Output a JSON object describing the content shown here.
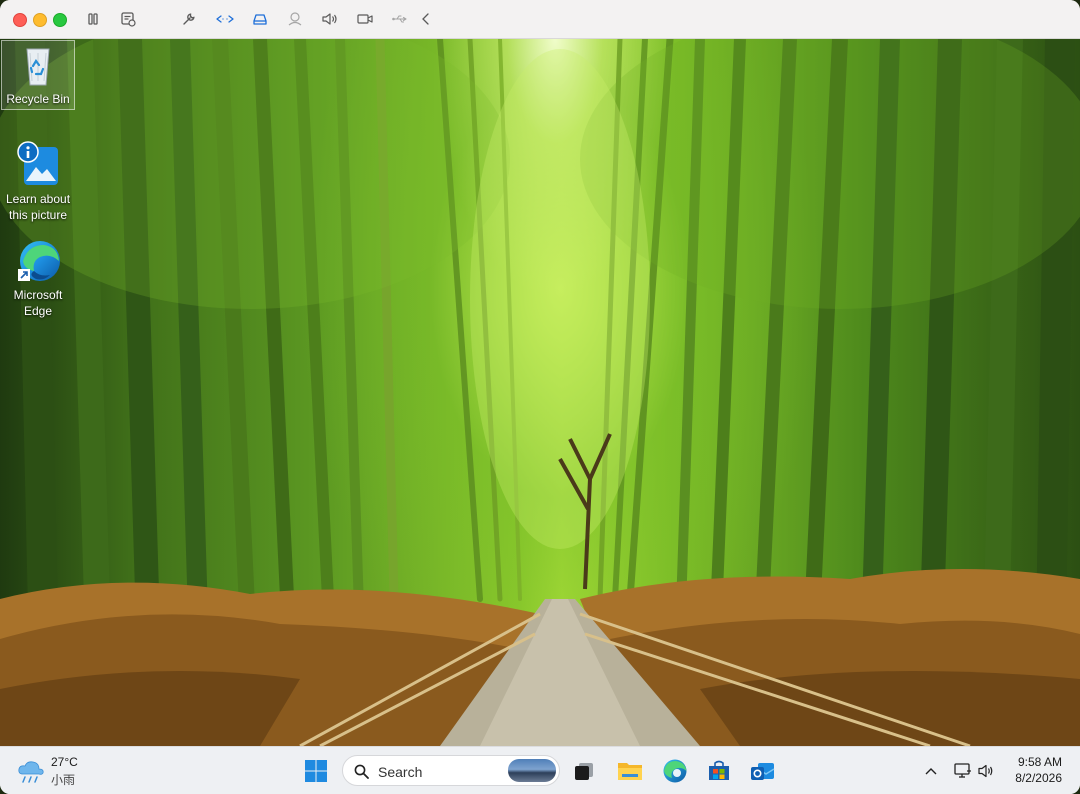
{
  "vm_toolbar": {
    "buttons": [
      "pause-icon",
      "snapshot-icon",
      "wrench-icon",
      "resize-icon",
      "drive-icon",
      "user-icon",
      "volume-icon",
      "camera-icon",
      "usb-icon",
      "chevron-left-icon"
    ]
  },
  "desktop": {
    "icons": [
      {
        "label": "Recycle Bin"
      },
      {
        "label": "Learn about this picture"
      },
      {
        "label": "Microsoft Edge"
      }
    ]
  },
  "taskbar": {
    "weather": {
      "temperature": "27°C",
      "condition": "小雨"
    },
    "search": {
      "placeholder": "Search"
    },
    "pinned": [
      "start-icon",
      "task-view-icon",
      "file-explorer-icon",
      "edge-icon",
      "store-icon",
      "outlook-icon"
    ],
    "clock": {
      "time": "9:58 AM",
      "date": "8/2/2026"
    }
  },
  "colors": {
    "accent": "#0067c0",
    "taskbar": "#eef0f3",
    "toolbar": "#f3f2f2"
  }
}
